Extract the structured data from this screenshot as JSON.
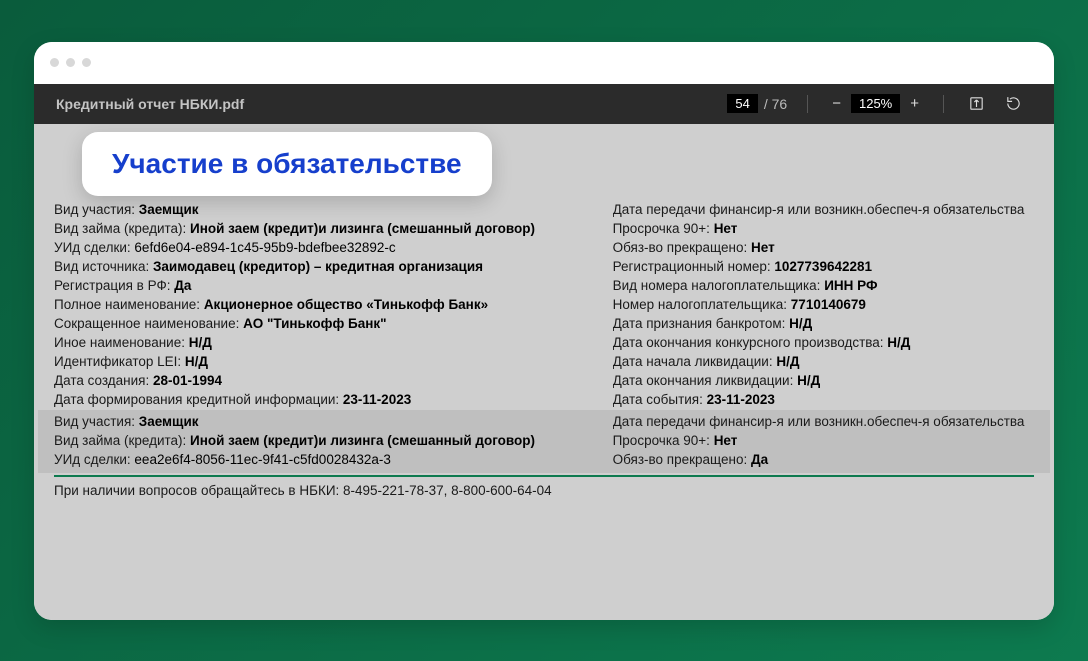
{
  "toolbar": {
    "filename": "Кредитный отчет НБКИ.pdf",
    "page_current": "54",
    "page_total": "76",
    "zoom": "125%"
  },
  "callout": "Участие в обязательстве",
  "block1": {
    "left": [
      {
        "label": "Вид участия: ",
        "value": "Заемщик"
      },
      {
        "label": "Вид займа (кредита): ",
        "value": "Иной заем (кредит)и лизинга (смешанный договор)"
      },
      {
        "label": "УИд сделки: ",
        "value": "6efd6e04-e894-1c45-95b9-bdefbee32892-c",
        "nobold": true
      },
      {
        "label": "Вид источника: ",
        "value": "Заимодавец (кредитор) – кредитная организация"
      },
      {
        "label": "Регистрация в РФ: ",
        "value": "Да"
      },
      {
        "label": "Полное наименование: ",
        "value": "Акционерное общество «Тинькофф Банк»"
      },
      {
        "label": "Сокращенное наименование: ",
        "value": "АО \"Тинькофф Банк\""
      },
      {
        "label": "Иное наименование: ",
        "value": "Н/Д"
      },
      {
        "label": "Идентификатор LEI: ",
        "value": "Н/Д"
      },
      {
        "label": "Дата создания: ",
        "value": "28-01-1994"
      },
      {
        "label": "Дата формирования кредитной информации: ",
        "value": "23-11-2023"
      }
    ],
    "right": [
      {
        "label": "Дата передачи финансир-я или возникн.обеспеч-я обязательства",
        "value": ""
      },
      {
        "label": "Просрочка 90+: ",
        "value": "Нет"
      },
      {
        "label": "Обяз-во прекращено: ",
        "value": "Нет"
      },
      {
        "label": "Регистрационный номер: ",
        "value": "1027739642281"
      },
      {
        "label": "Вид номера налогоплательщика: ",
        "value": "ИНН РФ"
      },
      {
        "label": "Номер налогоплательщика: ",
        "value": "7710140679"
      },
      {
        "label": "Дата признания банкротом: ",
        "value": "Н/Д"
      },
      {
        "label": "Дата окончания конкурсного производства: ",
        "value": "Н/Д"
      },
      {
        "label": "Дата начала ликвидации: ",
        "value": "Н/Д"
      },
      {
        "label": "Дата окончания ликвидации: ",
        "value": "Н/Д"
      },
      {
        "label": "Дата события: ",
        "value": "23-11-2023"
      }
    ]
  },
  "block2": {
    "left": [
      {
        "label": "Вид участия: ",
        "value": "Заемщик"
      },
      {
        "label": "Вид займа (кредита): ",
        "value": "Иной заем (кредит)и лизинга (смешанный договор)"
      },
      {
        "label": "УИд сделки: ",
        "value": "eea2e6f4-8056-11ec-9f41-c5fd0028432a-3",
        "nobold": true
      }
    ],
    "right": [
      {
        "label": "Дата передачи финансир-я или возникн.обеспеч-я обязательства",
        "value": ""
      },
      {
        "label": "Просрочка 90+: ",
        "value": "Нет"
      },
      {
        "label": "Обяз-во прекращено: ",
        "value": "Да"
      }
    ]
  },
  "footer": "При наличии вопросов обращайтесь в НБКИ: 8-495-221-78-37, 8-800-600-64-04"
}
